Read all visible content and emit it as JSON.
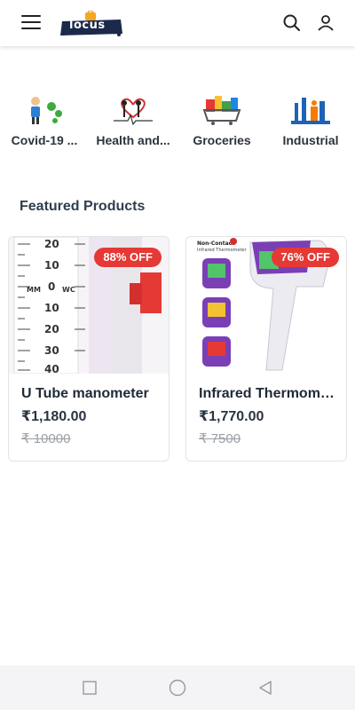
{
  "header": {
    "logo_text": "locus",
    "menu_icon": "hamburger-menu-icon",
    "search_icon": "search-icon",
    "account_icon": "user-icon"
  },
  "categories": [
    {
      "label": "Covid-19 ...",
      "icon": "covid-icon"
    },
    {
      "label": "Health and...",
      "icon": "health-icon"
    },
    {
      "label": "Groceries",
      "icon": "groceries-icon"
    },
    {
      "label": "Industrial",
      "icon": "industrial-icon"
    }
  ],
  "featured": {
    "title": "Featured Products",
    "products": [
      {
        "name": "U Tube manometer",
        "price": "₹1,180.00",
        "mrp": "₹ 10000",
        "discount": "88% OFF",
        "image_text": {
          "scale": [
            "20",
            "10",
            "0",
            "10",
            "20",
            "30",
            "40"
          ],
          "left_unit": "MM",
          "right_unit": "WC"
        }
      },
      {
        "name": "Infrared Thermometer",
        "price": "₹1,770.00",
        "mrp": "₹ 7500",
        "discount": "76% OFF",
        "image_text": {
          "line1": "Non-Contact",
          "line2": "Infrared Thermometer"
        }
      }
    ]
  },
  "colors": {
    "badge": "#e53935",
    "accent": "#7b3fb5"
  },
  "system_nav": {
    "recents_icon": "square-icon",
    "home_icon": "circle-icon",
    "back_icon": "back-triangle-icon"
  }
}
